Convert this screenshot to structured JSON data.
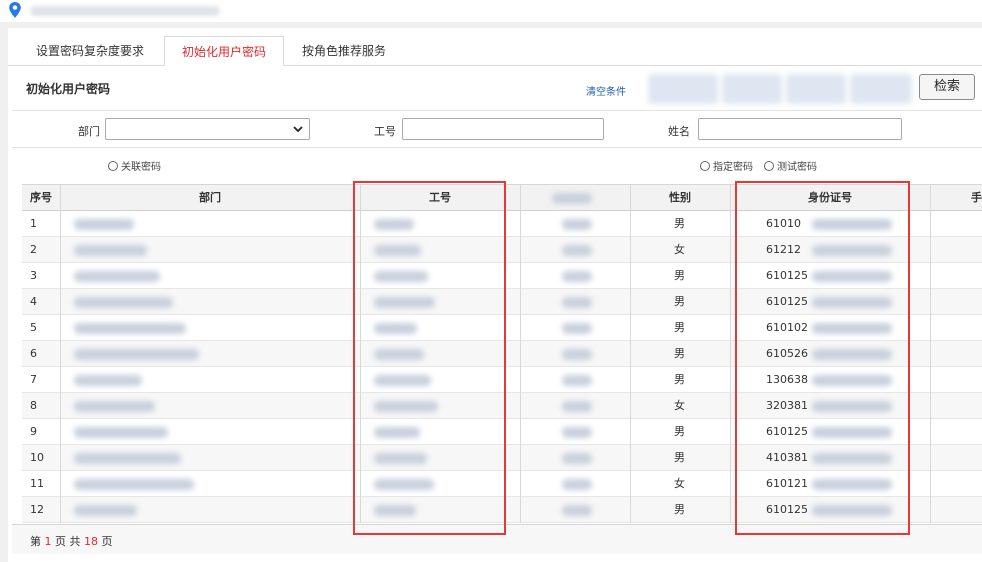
{
  "tabs": [
    {
      "label": "设置密码复杂度要求",
      "active": false
    },
    {
      "label": "初始化用户密码",
      "active": true
    },
    {
      "label": "按角色推荐服务",
      "active": false
    }
  ],
  "section_title": "初始化用户密码",
  "clear_link": "清空条件",
  "search_button": "检索",
  "filters": {
    "department_label": "部门",
    "employee_no_label": "工号",
    "name_label": "姓名",
    "department_value": "",
    "employee_no_value": "",
    "name_value": ""
  },
  "radios": {
    "linked_password": "关联密码",
    "specified_password": "指定密码",
    "test_password": "测试密码"
  },
  "table": {
    "columns": [
      "序号",
      "部门",
      "工号",
      "",
      "性别",
      "身份证号",
      "手"
    ],
    "rows": [
      {
        "index": "1",
        "gender": "男",
        "id_prefix": "61010"
      },
      {
        "index": "2",
        "gender": "女",
        "id_prefix": "61212"
      },
      {
        "index": "3",
        "gender": "男",
        "id_prefix": "610125"
      },
      {
        "index": "4",
        "gender": "男",
        "id_prefix": "610125"
      },
      {
        "index": "5",
        "gender": "男",
        "id_prefix": "610102"
      },
      {
        "index": "6",
        "gender": "男",
        "id_prefix": "610526"
      },
      {
        "index": "7",
        "gender": "男",
        "id_prefix": "130638"
      },
      {
        "index": "8",
        "gender": "女",
        "id_prefix": "320381"
      },
      {
        "index": "9",
        "gender": "男",
        "id_prefix": "610125"
      },
      {
        "index": "10",
        "gender": "男",
        "id_prefix": "410381"
      },
      {
        "index": "11",
        "gender": "女",
        "id_prefix": "610121"
      },
      {
        "index": "12",
        "gender": "男",
        "id_prefix": "610125"
      }
    ]
  },
  "pager": {
    "prefix": "第",
    "current_page": "1",
    "page_word": "页",
    "total_prefix": "共",
    "total_pages": "18",
    "total_suffix": "页"
  },
  "colors": {
    "accent_red": "#e0292c",
    "highlight_red": "#e53935",
    "link_blue": "#1f5fb0",
    "location_icon": "#2a7ae2"
  },
  "icons": {
    "location": "map-pin-icon",
    "select_arrow": "chevron-down-icon"
  }
}
